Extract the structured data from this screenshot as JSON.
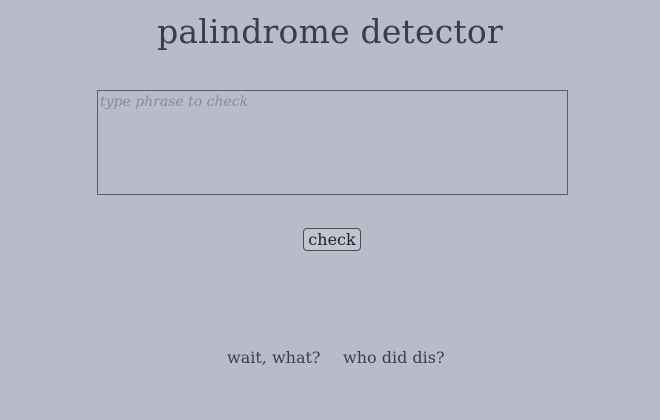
{
  "page": {
    "title": "palindrome detector"
  },
  "input": {
    "placeholder": "type phrase to check",
    "value": ""
  },
  "button": {
    "check_label": "check"
  },
  "footer": {
    "links": [
      {
        "label": "wait, what?"
      },
      {
        "label": "who did dis?"
      }
    ]
  },
  "colors": {
    "background": "#b9bcc8",
    "text": "#3a3d4e",
    "border": "#5a5d6e",
    "placeholder": "#8a8c98"
  }
}
